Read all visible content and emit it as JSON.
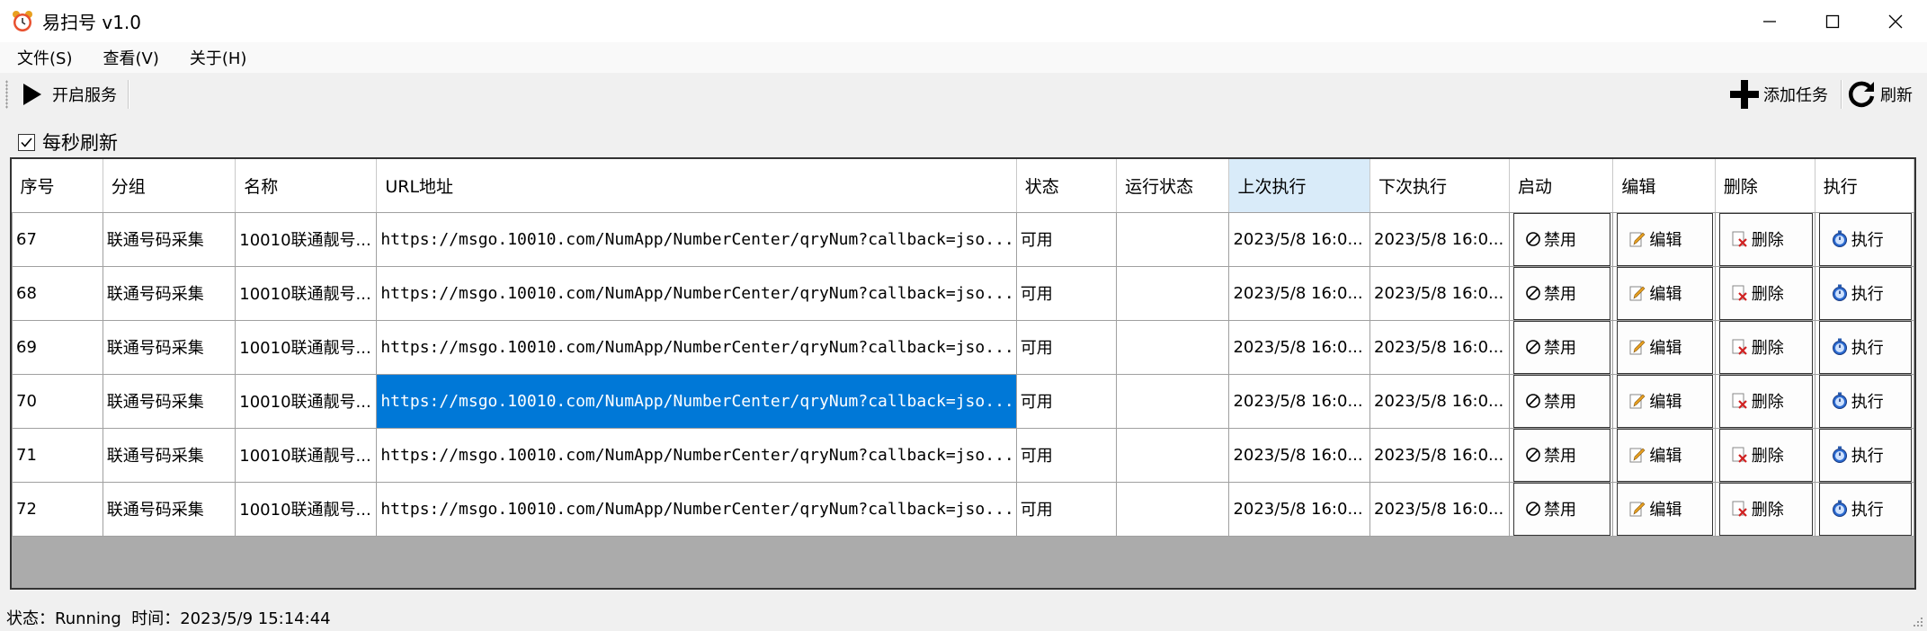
{
  "window": {
    "title": "易扫号 v1.0",
    "icon": "alarm-clock-icon",
    "controls": [
      "minimize-icon",
      "maximize-icon",
      "close-icon"
    ]
  },
  "menu": [
    "文件(S)",
    "查看(V)",
    "关于(H)"
  ],
  "toolbar": {
    "start_service": "开启服务",
    "add_task": "添加任务",
    "refresh": "刷新"
  },
  "options": {
    "auto_refresh_label": "每秒刷新",
    "auto_refresh_checked": true
  },
  "table": {
    "columns": [
      "序号",
      "分组",
      "名称",
      "URL地址",
      "状态",
      "运行状态",
      "上次执行",
      "下次执行",
      "启动",
      "编辑",
      "删除",
      "执行"
    ],
    "sorted_column": "上次执行",
    "button_labels": {
      "disable": "禁用",
      "edit": "编辑",
      "delete": "删除",
      "run": "执行"
    },
    "rows": [
      {
        "id": "67",
        "group": "联通号码采集",
        "name": "10010联通靓号...",
        "url": "https://msgo.10010.com/NumApp/NumberCenter/qryNum?callback=jso...",
        "status": "可用",
        "run_status": "",
        "last_run": "2023/5/8 16:0...",
        "next_run": "2023/5/8 16:0..."
      },
      {
        "id": "68",
        "group": "联通号码采集",
        "name": "10010联通靓号...",
        "url": "https://msgo.10010.com/NumApp/NumberCenter/qryNum?callback=jso...",
        "status": "可用",
        "run_status": "",
        "last_run": "2023/5/8 16:0...",
        "next_run": "2023/5/8 16:0..."
      },
      {
        "id": "69",
        "group": "联通号码采集",
        "name": "10010联通靓号...",
        "url": "https://msgo.10010.com/NumApp/NumberCenter/qryNum?callback=jso...",
        "status": "可用",
        "run_status": "",
        "last_run": "2023/5/8 16:0...",
        "next_run": "2023/5/8 16:0..."
      },
      {
        "id": "70",
        "group": "联通号码采集",
        "name": "10010联通靓号...",
        "url": "https://msgo.10010.com/NumApp/NumberCenter/qryNum?callback=jso...",
        "status": "可用",
        "run_status": "",
        "last_run": "2023/5/8 16:0...",
        "next_run": "2023/5/8 16:0..."
      },
      {
        "id": "71",
        "group": "联通号码采集",
        "name": "10010联通靓号...",
        "url": "https://msgo.10010.com/NumApp/NumberCenter/qryNum?callback=jso...",
        "status": "可用",
        "run_status": "",
        "last_run": "2023/5/8 16:0...",
        "next_run": "2023/5/8 16:0..."
      },
      {
        "id": "72",
        "group": "联通号码采集",
        "name": "10010联通靓号...",
        "url": "https://msgo.10010.com/NumApp/NumberCenter/qryNum?callback=jso...",
        "status": "可用",
        "run_status": "",
        "last_run": "2023/5/8 16:0...",
        "next_run": "2023/5/8 16:0..."
      }
    ],
    "selected_cell": {
      "row": "70",
      "column": "URL地址"
    }
  },
  "statusbar": {
    "text": "状态：Running  时间：2023/5/9 15:14:44"
  },
  "colors": {
    "selection": "#0078d7",
    "sorted_header": "#d9ebf9",
    "grid_empty_area": "#ababab"
  }
}
